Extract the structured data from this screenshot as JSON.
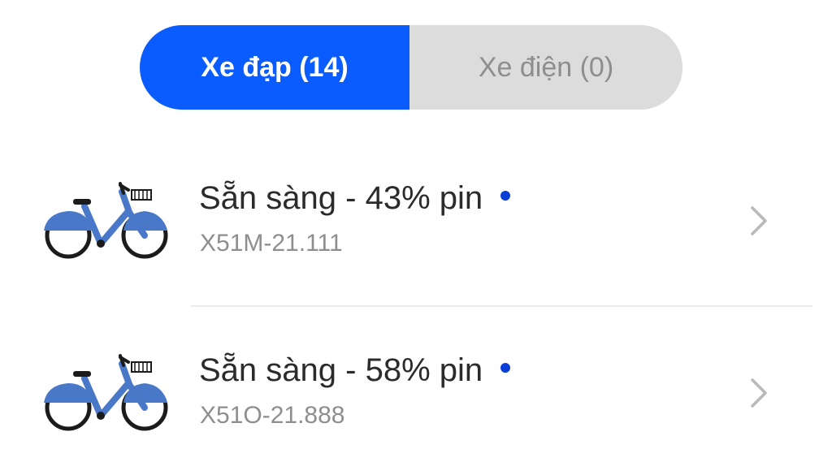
{
  "tabs": [
    {
      "label": "Xe đạp (14)",
      "active": true
    },
    {
      "label": "Xe điện (0)",
      "active": false
    }
  ],
  "vehicles": [
    {
      "status": "Sẵn sàng - 43% pin",
      "code": "X51M-21.111",
      "icon": "bicycle-icon"
    },
    {
      "status": "Sẵn sàng - 58% pin",
      "code": "X51O-21.888",
      "icon": "bicycle-icon"
    }
  ],
  "colors": {
    "accent": "#0a5cff",
    "tab_inactive_bg": "#dcdcdc",
    "muted_text": "#8e8e8e",
    "bike_blue": "#4a78c8",
    "status_dot": "#0a3fd6"
  }
}
